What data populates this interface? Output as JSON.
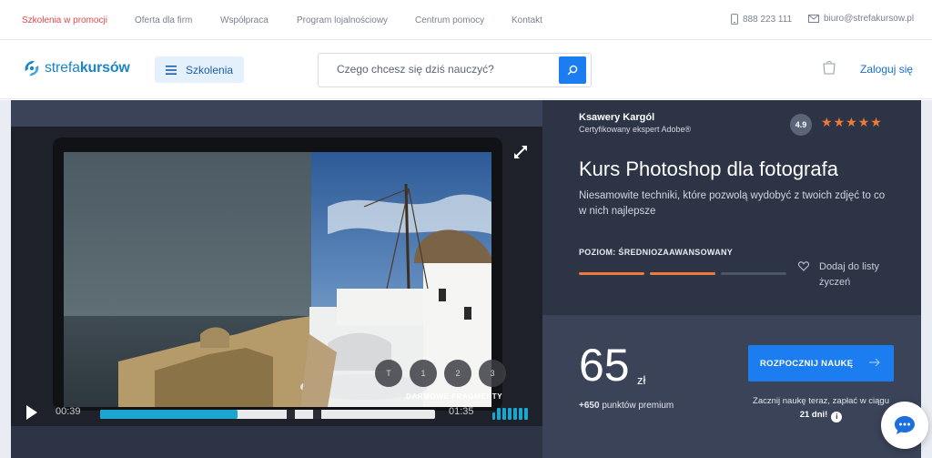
{
  "topbar": {
    "links": [
      {
        "label": "Szkolenia w promocji",
        "promo": true
      },
      {
        "label": "Oferta dla firm"
      },
      {
        "label": "Współpraca"
      },
      {
        "label": "Program lojalnościowy"
      },
      {
        "label": "Centrum pomocy"
      },
      {
        "label": "Kontakt"
      }
    ],
    "phone": "888 223 111",
    "email": "biuro@strefakursow.pl"
  },
  "header": {
    "logo_prefix": "strefa",
    "logo_suffix": "kursów",
    "categories_label": "Szkolenia",
    "search_placeholder": "Czego chcesz się dziś nauczyć?",
    "login_label": "Zaloguj się"
  },
  "video": {
    "fragments": [
      "T",
      "1",
      "2",
      "3"
    ],
    "fragments_label": "DARMOWE FRAGMENTY",
    "current_time": "00:39",
    "duration": "01:35",
    "progress": 0.41
  },
  "course": {
    "author_name": "Ksawery Kargól",
    "author_title": "Certyfikowany ekspert Adobe®",
    "rating": "4.9",
    "stars": 5,
    "title": "Kurs Photoshop dla fotografa",
    "description": "Niesamowite techniki, które pozwolą wydobyć z twoich zdjęć to co w nich najlepsze",
    "level_label": "POZIOM: ŚREDNIOZAAWANSOWANY",
    "level_filled": 2,
    "level_total": 3,
    "wishlist_label": "Dodaj do listy życzeń"
  },
  "pricing": {
    "price": "65",
    "currency": "zł",
    "points_value": "+650",
    "points_label": "punktów premium",
    "cta_label": "ROZPOCZNIJ NAUKĘ",
    "pay_note": "Zacznij naukę teraz, zapłać w ciągu",
    "pay_days": "21 dni!",
    "info_icon": "i"
  },
  "colors": {
    "accent_blue": "#1c7df0",
    "promo_red": "#e5474c",
    "star_orange": "#f07a39",
    "panel_dark": "#2d3446",
    "panel_mid": "#3b4359",
    "progress_teal": "#1aa6cf"
  }
}
